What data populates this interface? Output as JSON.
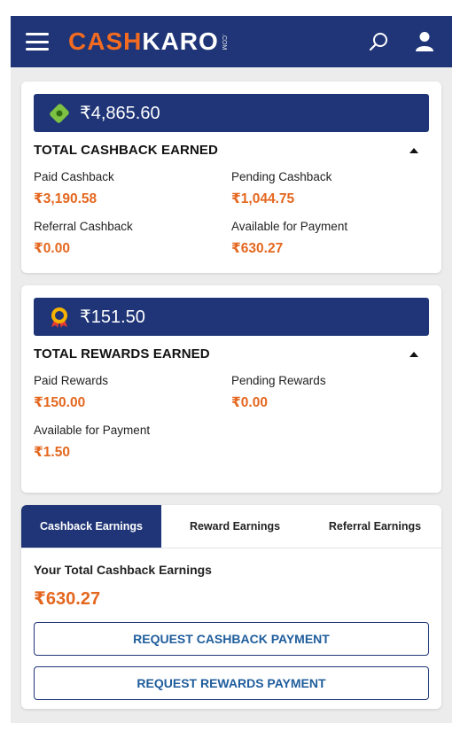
{
  "header": {
    "logo_cash": "CASH",
    "logo_karo": "KARO",
    "logo_com": ".COM",
    "brand_color": "#1f3577",
    "accent_color": "#f26b21",
    "icons": [
      "menu-icon",
      "search-icon",
      "user-icon"
    ]
  },
  "cashback_card": {
    "total_amount": "₹4,865.60",
    "title": "TOTAL CASHBACK EARNED",
    "icon": "wallet-icon",
    "items": [
      {
        "label": "Paid Cashback",
        "value": "₹3,190.58"
      },
      {
        "label": "Pending Cashback",
        "value": "₹1,044.75"
      },
      {
        "label": "Referral Cashback",
        "value": "₹0.00"
      },
      {
        "label": "Available for Payment",
        "value": "₹630.27"
      }
    ]
  },
  "rewards_card": {
    "total_amount": "₹151.50",
    "title": "TOTAL REWARDS EARNED",
    "icon": "reward-badge-icon",
    "items": [
      {
        "label": "Paid Rewards",
        "value": "₹150.00"
      },
      {
        "label": "Pending Rewards",
        "value": "₹0.00"
      },
      {
        "label": "Available for Payment",
        "value": "₹1.50"
      }
    ]
  },
  "earnings": {
    "tabs": [
      {
        "label": "Cashback Earnings",
        "active": true
      },
      {
        "label": "Reward Earnings",
        "active": false
      },
      {
        "label": "Referral Earnings",
        "active": false
      }
    ],
    "total_label": "Your Total Cashback Earnings",
    "total_value": "₹630.27",
    "request_cashback_label": "REQUEST CASHBACK PAYMENT",
    "request_rewards_label": "REQUEST REWARDS PAYMENT"
  }
}
